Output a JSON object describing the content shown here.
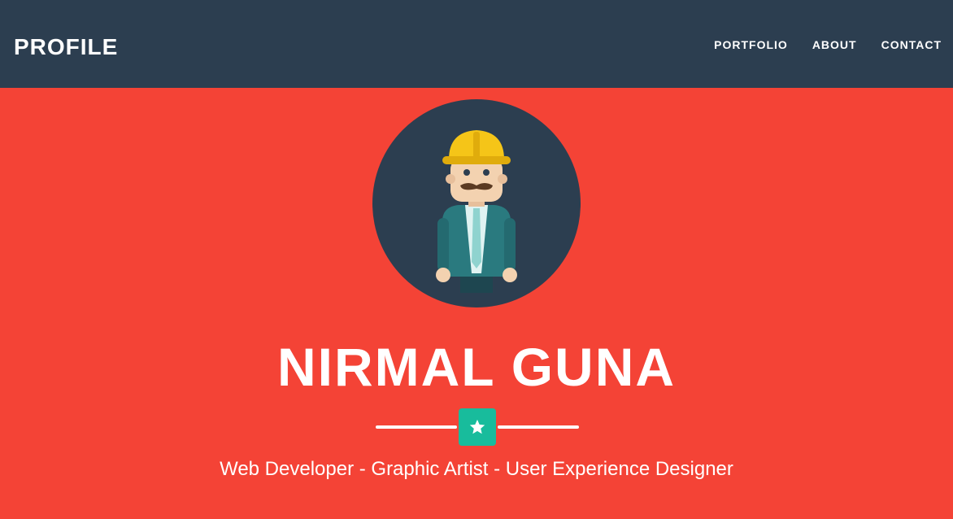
{
  "navbar": {
    "brand": "PROFILE",
    "links": [
      "PORTFOLIO",
      "ABOUT",
      "CONTACT"
    ]
  },
  "hero": {
    "name": "NIRMAL GUNA",
    "tagline": "Web Developer - Graphic Artist - User Experience Designer",
    "avatar_icon": "construction-worker-avatar-icon",
    "divider_icon": "star-icon"
  },
  "colors": {
    "navbar_bg": "#2c3e50",
    "hero_bg": "#f44336",
    "accent": "#18bc9c",
    "avatar_bg": "#2c3e50",
    "text": "#ffffff"
  }
}
